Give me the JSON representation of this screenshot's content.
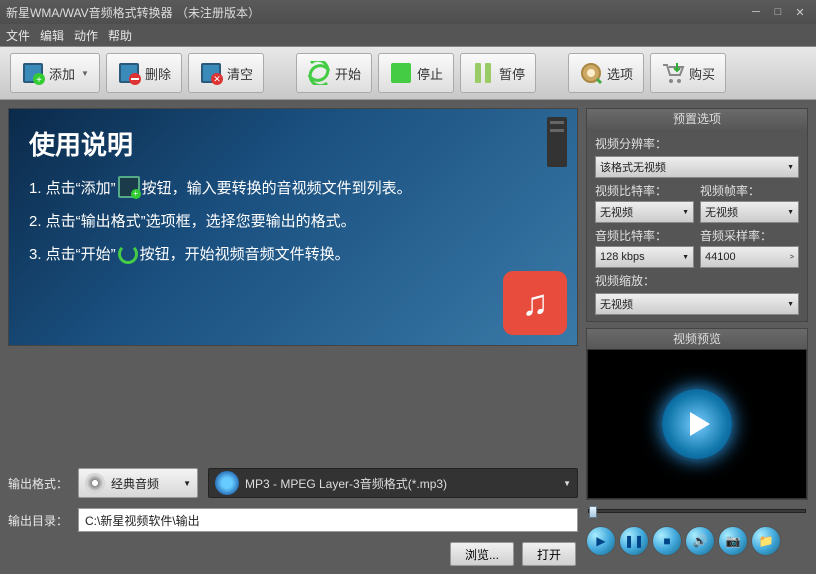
{
  "title": "新星WMA/WAV音频格式转换器  （未注册版本）",
  "menu": {
    "file": "文件",
    "edit": "编辑",
    "action": "动作",
    "help": "帮助"
  },
  "toolbar": {
    "add": "添加",
    "delete": "删除",
    "clear": "清空",
    "start": "开始",
    "stop": "停止",
    "pause": "暂停",
    "options": "选项",
    "buy": "购买"
  },
  "banner": {
    "title": "使用说明",
    "s1a": "1. 点击“添加”",
    "s1b": "按钮，输入要转换的音视频文件到列表。",
    "s2": "2. 点击“输出格式”选项框，选择您要输出的格式。",
    "s3a": "3. 点击“开始”",
    "s3b": "按钮，开始视频音频文件转换。"
  },
  "output": {
    "format_label": "输出格式：",
    "category": "经典音频",
    "format": "MP3 - MPEG Layer-3音频格式(*.mp3)",
    "dir_label": "输出目录：",
    "dir": "C:\\新星视频软件\\输出",
    "browse": "浏览...",
    "open": "打开"
  },
  "preset": {
    "panel_title": "预置选项",
    "res_label": "视频分辨率：",
    "res_value": "该格式无视频",
    "vbr_label": "视频比特率：",
    "vbr_value": "无视频",
    "fps_label": "视频帧率：",
    "fps_value": "无视频",
    "abr_label": "音频比特率：",
    "abr_value": "128 kbps",
    "asr_label": "音频采样率：",
    "asr_value": "44100",
    "scale_label": "视频缩放：",
    "scale_value": "无视频"
  },
  "preview": {
    "panel_title": "视频预览"
  }
}
